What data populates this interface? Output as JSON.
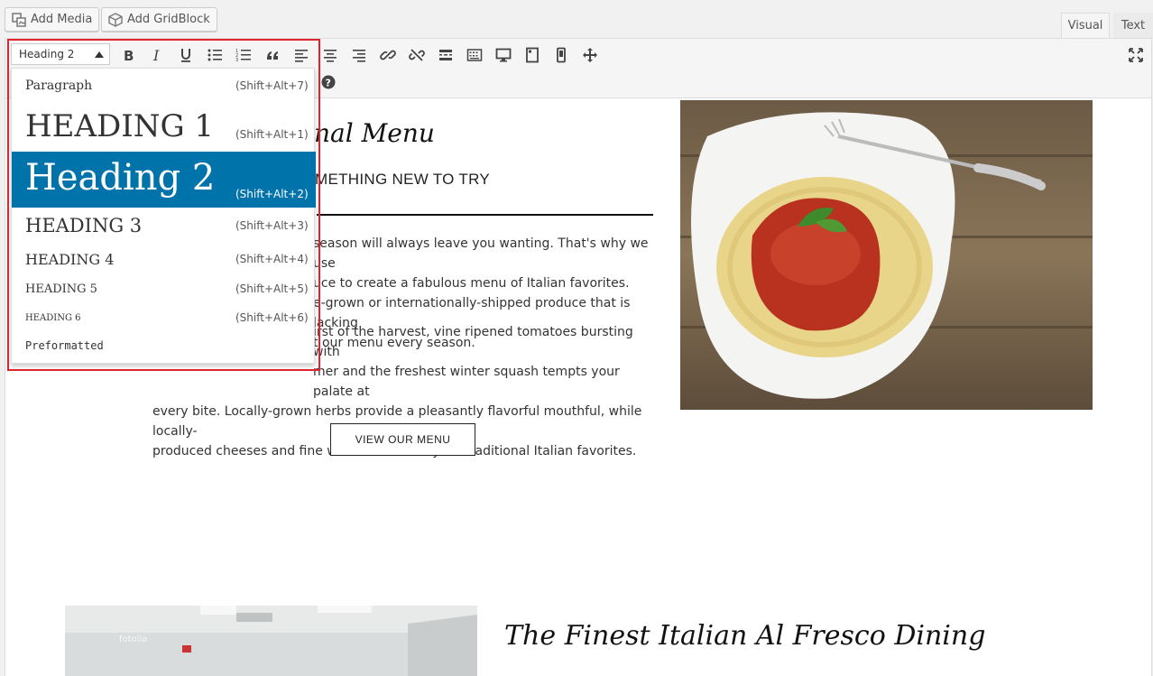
{
  "top_buttons": {
    "add_media": "Add Media",
    "add_gridblock": "Add GridBlock"
  },
  "tabs": {
    "visual": "Visual",
    "text": "Text"
  },
  "format_select": {
    "value": "Heading 2"
  },
  "format_menu": [
    {
      "label": "Paragraph",
      "shortcut": "(Shift+Alt+7)"
    },
    {
      "label": "HEADING 1",
      "shortcut": "(Shift+Alt+1)"
    },
    {
      "label": "Heading 2",
      "shortcut": "(Shift+Alt+2)"
    },
    {
      "label": "HEADING 3",
      "shortcut": "(Shift+Alt+3)"
    },
    {
      "label": "HEADING 4",
      "shortcut": "(Shift+Alt+4)"
    },
    {
      "label": "HEADING 5",
      "shortcut": "(Shift+Alt+5)"
    },
    {
      "label": "HEADING 6",
      "shortcut": "(Shift+Alt+6)"
    },
    {
      "label": "Preformatted",
      "shortcut": ""
    }
  ],
  "toolbar_icons": [
    "bold-icon",
    "italic-icon",
    "underline-icon",
    "bullet-list-icon",
    "numbered-list-icon",
    "blockquote-icon",
    "align-left-icon",
    "align-center-icon",
    "align-right-icon",
    "link-icon",
    "unlink-icon",
    "read-more-icon",
    "toolbar-toggle-icon",
    "desktop-preview-icon",
    "tablet-preview-icon",
    "mobile-preview-icon",
    "move-icon",
    "fullscreen-icon",
    "help-icon"
  ],
  "content": {
    "menu_title": "nal Menu",
    "menu_subtitle": "METHING NEW TO TRY",
    "para1": [
      "season will always leave you wanting. That's why we use",
      "uce to create a fabulous menu of Italian favorites.",
      "e-grown or internationally-shipped produce that is lacking",
      "t our menu every season."
    ],
    "para2": [
      "irst of the harvest, vine ripened tomatoes bursting with",
      "mer and the freshest winter squash tempts your palate at",
      "every bite. Locally-grown herbs provide a pleasantly flavorful mouthful, while locally-",
      "produced cheeses and fine wines round out your traditional Italian favorites."
    ],
    "view_menu_button": "VIEW OUR MENU",
    "fresco_title": "The Finest Italian Al Fresco Dining",
    "watermark": "fotolia"
  },
  "colors": {
    "selected": "#0073aa",
    "highlight_border": "#e0232c"
  }
}
